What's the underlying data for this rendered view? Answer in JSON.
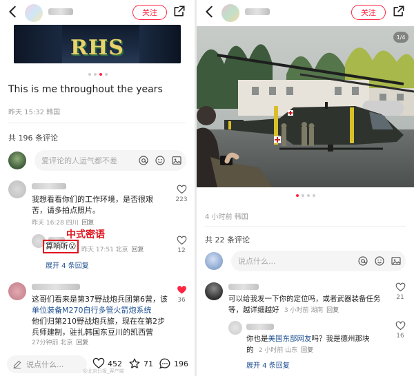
{
  "left": {
    "follow_label": "关注",
    "post_title": "This is me throughout the years",
    "post_meta": "昨天 15:32 韩国",
    "comment_count": "共 196 条评论",
    "input_placeholder": "爱评论的人运气都不差",
    "comments": [
      {
        "text_line1": "我想看看你们的工作环境，是否很艰",
        "text_line2": "苦，请多拍点照片。",
        "meta": "昨天 16:28 四川",
        "reply": "回复",
        "likes": "223",
        "sub_reply": {
          "highlight_text": "算响听",
          "emoji": "😮",
          "meta": "昨天 17:51 北京",
          "reply": "回复",
          "likes": "12"
        },
        "expand": "展开 4 条回复"
      },
      {
        "text_line1": "这哥们看来是第37野战炮兵团第6营，该",
        "text_line2": "单位装备M270自行多管火箭炮系统",
        "text_line3": "他们归第210野战炮兵旅，现在在第2步",
        "text_line4": "兵师建制，驻扎韩国东豆川的凯西营",
        "meta": "27分钟前 北京",
        "reply": "回复",
        "likes": "36",
        "liked": true
      }
    ],
    "annotation": "中式密语",
    "bottom": {
      "input_label": "说点什么...",
      "likes": "452",
      "favorites": "71",
      "comments": "196",
      "watermark": "@北京日报_客户端"
    }
  },
  "right": {
    "follow_label": "关注",
    "image_counter": "1/4",
    "post_meta": "4 小时前 韩国",
    "comment_count": "共 22 条评论",
    "input_placeholder": "说点什么...",
    "comments": [
      {
        "text_line1": "可以给我发一下你的定位吗，或者武器装备任务",
        "text_line2": "等，越详细越好",
        "meta": "3 小时前 湖南",
        "reply": "回复",
        "likes": "21",
        "sub_reply": {
          "text_pre": "你也是",
          "text_link": "美国东部网友",
          "text_post": "吗？我是德州那块",
          "text_line2": "的",
          "meta": "2 小时前 山东",
          "reply": "回复",
          "likes": "16"
        },
        "expand": "展开 4 条回复"
      }
    ]
  },
  "colors": {
    "accent": "#ff2442",
    "link": "#1d4f91",
    "annotation": "#e0141e",
    "muted": "#999999"
  },
  "icons": [
    "back-arrow-icon",
    "share-icon",
    "at-icon",
    "emoji-icon",
    "image-icon",
    "heart-icon",
    "star-icon",
    "comment-bubble-icon",
    "pencil-icon"
  ]
}
